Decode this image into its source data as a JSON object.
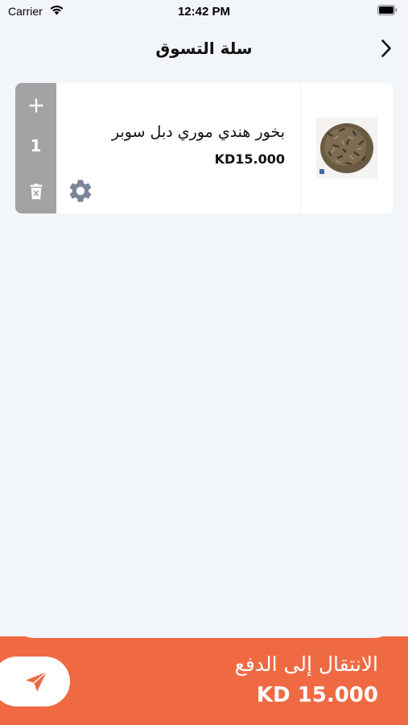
{
  "status_bar": {
    "carrier": "Carrier",
    "time": "12:42 PM"
  },
  "header": {
    "title": "سلة التسوق",
    "back_icon": "chevron-right-icon"
  },
  "cart": {
    "items": [
      {
        "name": "بخور هندي موري دبل سوبر",
        "price": "KD15.000",
        "quantity": "1",
        "image": "incense-pile-photo"
      }
    ]
  },
  "checkout": {
    "label": "الانتقال إلى الدفع",
    "total": "KD 15.000",
    "send_icon": "send-icon"
  },
  "colors": {
    "accent": "#ef6a43",
    "background": "#f2f5f9",
    "quantity_panel": "#a3a3a3",
    "gear": "#7a8499"
  }
}
